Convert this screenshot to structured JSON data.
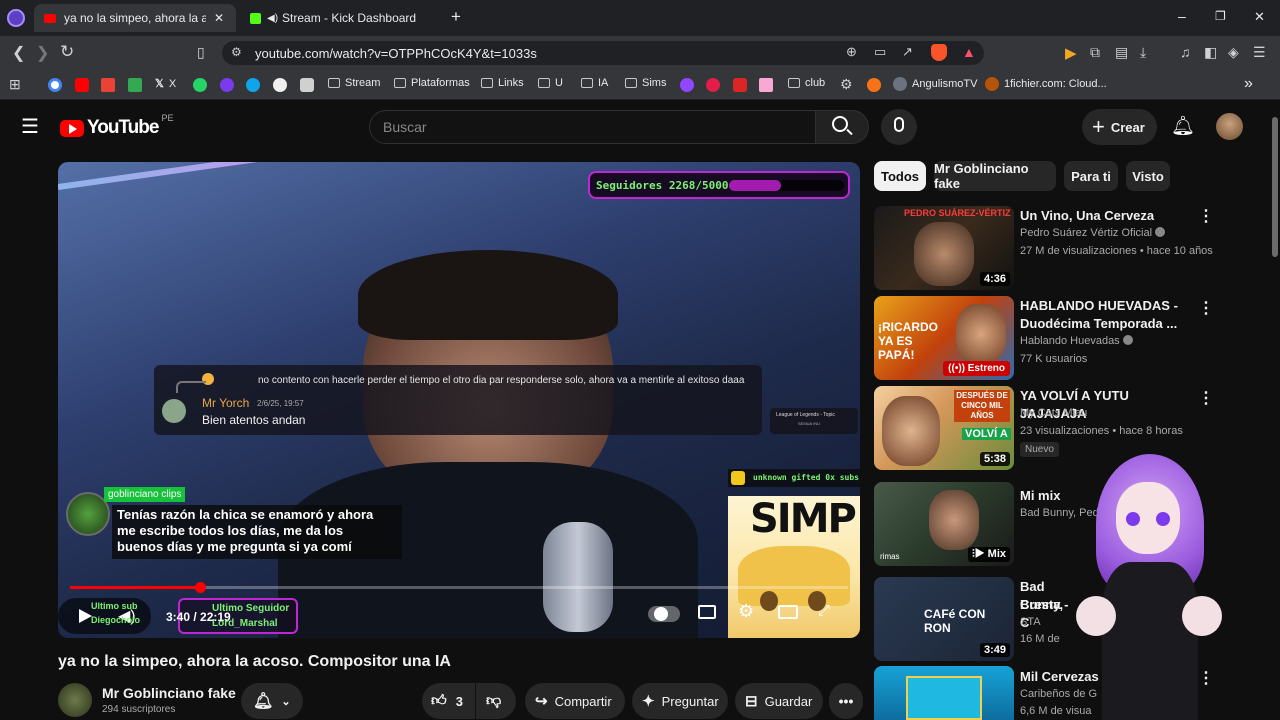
{
  "browser": {
    "tabs": [
      {
        "title": "ya no la simpeo, ahora la acoso."
      },
      {
        "title": "Stream - Kick Dashboard"
      }
    ],
    "new_tab": "+",
    "window_controls": [
      "–",
      "❐",
      "✕"
    ],
    "url": "youtube.com/watch?v=OTPPhCOcK4Y&t=1033s",
    "bookmarks": [
      "X",
      "Stream",
      "Plataformas",
      "Links",
      "U",
      "IA",
      "Sims",
      "club",
      "AngulismoTV",
      "1fichier.com: Cloud..."
    ],
    "overflow": "»"
  },
  "yt": {
    "logo_text": "YouTube",
    "region": "PE",
    "search_placeholder": "Buscar",
    "create_label": "Crear",
    "chips": [
      "Todos",
      "Mr Goblinciano fake",
      "Para ti",
      "Visto"
    ]
  },
  "video": {
    "followers_label": "Seguidores 2268/5000",
    "followers_progress": 0.45,
    "chat_message": "no contento con hacerle perder el tiempo el otro dia par responderse solo, ahora va a mentirle al exitoso daaa",
    "chat_user": "Mr Yorch",
    "chat_time": "2/6/25, 19:57",
    "chat_reply": "Bien atentos andan",
    "lol_label": "League of Legends - Topic",
    "lol_sub": "SEMUA INU",
    "clip_tag": "goblinciano clips",
    "subtitle_l1": "Tenías razón la chica se enamoró y ahora",
    "subtitle_l2": "me escribe todos los días, me da los",
    "subtitle_l3": "buenos días y me pregunta si ya comí",
    "gift_text": "unknown gifted 0x subs!",
    "simp_text": "SIMP",
    "ultimo_sub_l1": "Ultimo sub",
    "ultimo_sub_l2": "Diegocholo",
    "time": "3:40 / 22:19",
    "ultimo_seg_l1": "Ultimo Seguidor",
    "ultimo_seg_l2": "Lord_Marshal",
    "progress": 0.167
  },
  "meta": {
    "title": "ya no la simpeo, ahora la acoso. Compositor una IA",
    "channel": "Mr Goblinciano fake",
    "subs": "294 suscriptores",
    "likes": "3",
    "share": "Compartir",
    "ask": "Preguntar",
    "save": "Guardar"
  },
  "related": [
    {
      "title": "Un Vino, Una Cerveza",
      "channel": "Pedro Suárez Vértiz Oficial",
      "stats": "27 M de visualizaciones • hace 10 años",
      "duration": "4:36",
      "thumb_text": "PEDRO SUÁREZ-VÉRTIZ"
    },
    {
      "title": "HABLANDO HUEVADAS - Duodécima Temporada ...",
      "channel": "Hablando Huevadas",
      "stats": "77 K usuarios",
      "badge": "Estreno",
      "thumb_text": "¡RICARDO YA ES PAPÁ!"
    },
    {
      "title": "YA VOLVÍ A YUTU JAJAJAJA",
      "channel": "My Cats Miau",
      "stats": "23 visualizaciones • hace 8 horas",
      "duration": "5:38",
      "badge": "Nuevo",
      "thumb_text": "DESPUÉS DE CINCO MIL AÑOS",
      "thumb_text2": "VOLVÍ A"
    },
    {
      "title": "Mi mix",
      "channel": "Bad Bunny, Pedro",
      "stats": "",
      "duration": "Mix",
      "thumb_text": "rimas"
    },
    {
      "title": "Bad Bunny,",
      "title2": "Cresta - C",
      "channel": "STA",
      "stats": "16 M de",
      "duration": "3:49",
      "thumb_text": "CAFé CON RON"
    },
    {
      "title": "Mil Cervezas",
      "channel": "Caribeños de G",
      "stats": "6,6 M de visua"
    }
  ]
}
